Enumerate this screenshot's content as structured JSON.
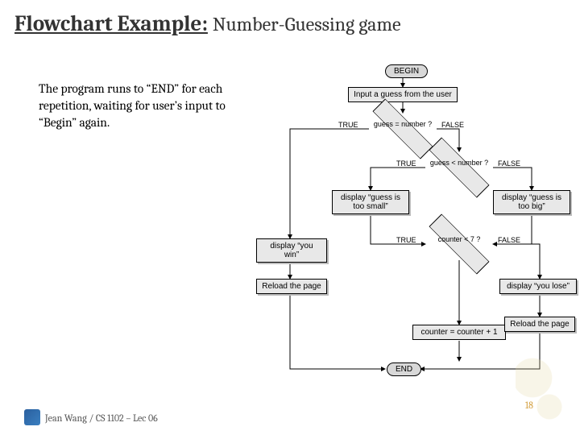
{
  "title_main": "Flowchart Example:",
  "title_sub": "Number-Guessing game",
  "description": "The program runs to “END” for each repetition, waiting for user’s input to “Begin” again.",
  "flowchart": {
    "begin": "BEGIN",
    "input": "Input a guess from the user",
    "dec1": "guess = number ?",
    "dec2": "guess < number ?",
    "disp_small": "display “guess is too small”",
    "disp_big": "display “guess is too big”",
    "win": "display “you win”",
    "dec3": "counter < 7 ?",
    "reload1": "Reload the page",
    "lose": "display “you lose”",
    "counter": "counter = counter + 1",
    "reload2": "Reload the page",
    "end": "END",
    "t": "TRUE",
    "f": "FALSE"
  },
  "footer": "Jean Wang / CS 1102 – Lec 06",
  "pagenum": "18"
}
